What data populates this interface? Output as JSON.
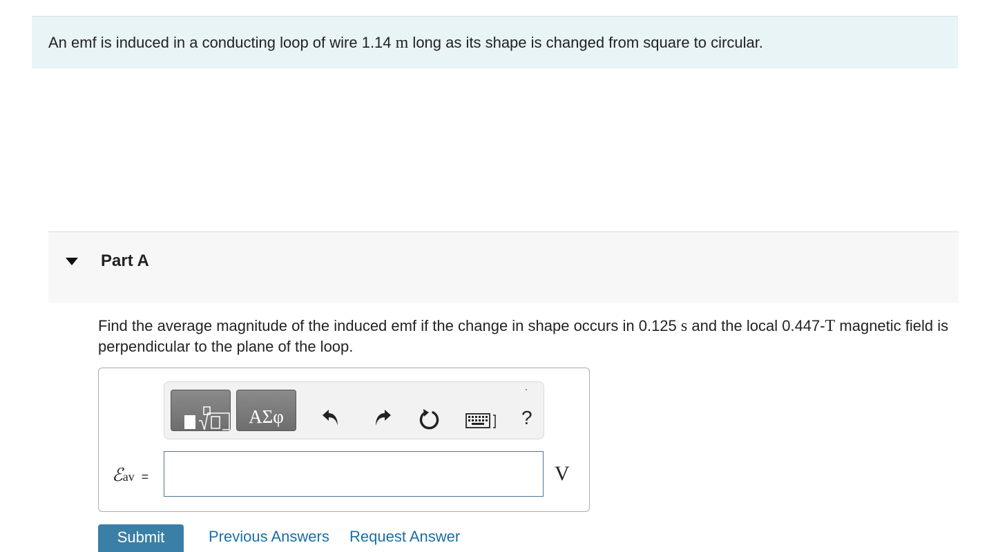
{
  "intro": {
    "text_before": "An emf is induced in a conducting loop of wire 1.14 ",
    "unit": "m",
    "text_after": " long as its shape is changed from square to circular."
  },
  "part": {
    "title": "Part A"
  },
  "question": {
    "text_1": "Find the average magnitude of the induced emf if the change in shape occurs in 0.125 ",
    "unit_time": "s",
    "text_2": " and the local 0.447-",
    "unit_field": "T",
    "text_3": " magnetic field is perpendicular to the plane of the loop."
  },
  "toolbar": {
    "templates_icon": "templates-icon",
    "symbols_label": "ΑΣφ",
    "undo_icon": "undo-icon",
    "redo_icon": "redo-icon",
    "reset_icon": "reset-icon",
    "keyboard_icon": "keyboard-icon",
    "help_label": "?"
  },
  "answer": {
    "symbol": "ℰ",
    "subscript": "av",
    "equals": "=",
    "value": "",
    "unit": "V"
  },
  "actions": {
    "submit_label": "Submit",
    "previous_answers_label": "Previous Answers",
    "request_answer_label": "Request Answer"
  },
  "colors": {
    "intro_bg": "#e8f4f6",
    "part_bg": "#f7f7f7",
    "toolbar_button": "#7a7a7a",
    "input_border": "#4a7a90",
    "submit_bg": "#3a7fa6",
    "link": "#1a6fa6"
  }
}
